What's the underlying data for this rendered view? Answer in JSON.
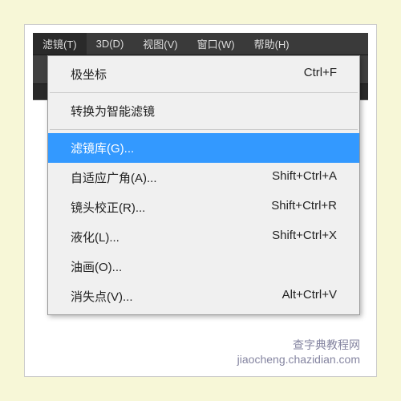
{
  "menubar": {
    "items": [
      {
        "label": "滤镜(T)"
      },
      {
        "label": "3D(D)"
      },
      {
        "label": "视图(V)"
      },
      {
        "label": "窗口(W)"
      },
      {
        "label": "帮助(H)"
      }
    ]
  },
  "dropdown": {
    "items": [
      {
        "label": "极坐标",
        "shortcut": "Ctrl+F"
      },
      {
        "sep": true
      },
      {
        "label": "转换为智能滤镜",
        "shortcut": ""
      },
      {
        "sep": true
      },
      {
        "label": "滤镜库(G)...",
        "shortcut": "",
        "highlighted": true
      },
      {
        "label": "自适应广角(A)...",
        "shortcut": "Shift+Ctrl+A"
      },
      {
        "label": "镜头校正(R)...",
        "shortcut": "Shift+Ctrl+R"
      },
      {
        "label": "液化(L)...",
        "shortcut": "Shift+Ctrl+X"
      },
      {
        "label": "油画(O)...",
        "shortcut": ""
      },
      {
        "label": "消失点(V)...",
        "shortcut": "Alt+Ctrl+V"
      }
    ]
  },
  "watermark": {
    "line1": "查字典教程网",
    "line2": "jiaocheng.chazidian.com"
  }
}
